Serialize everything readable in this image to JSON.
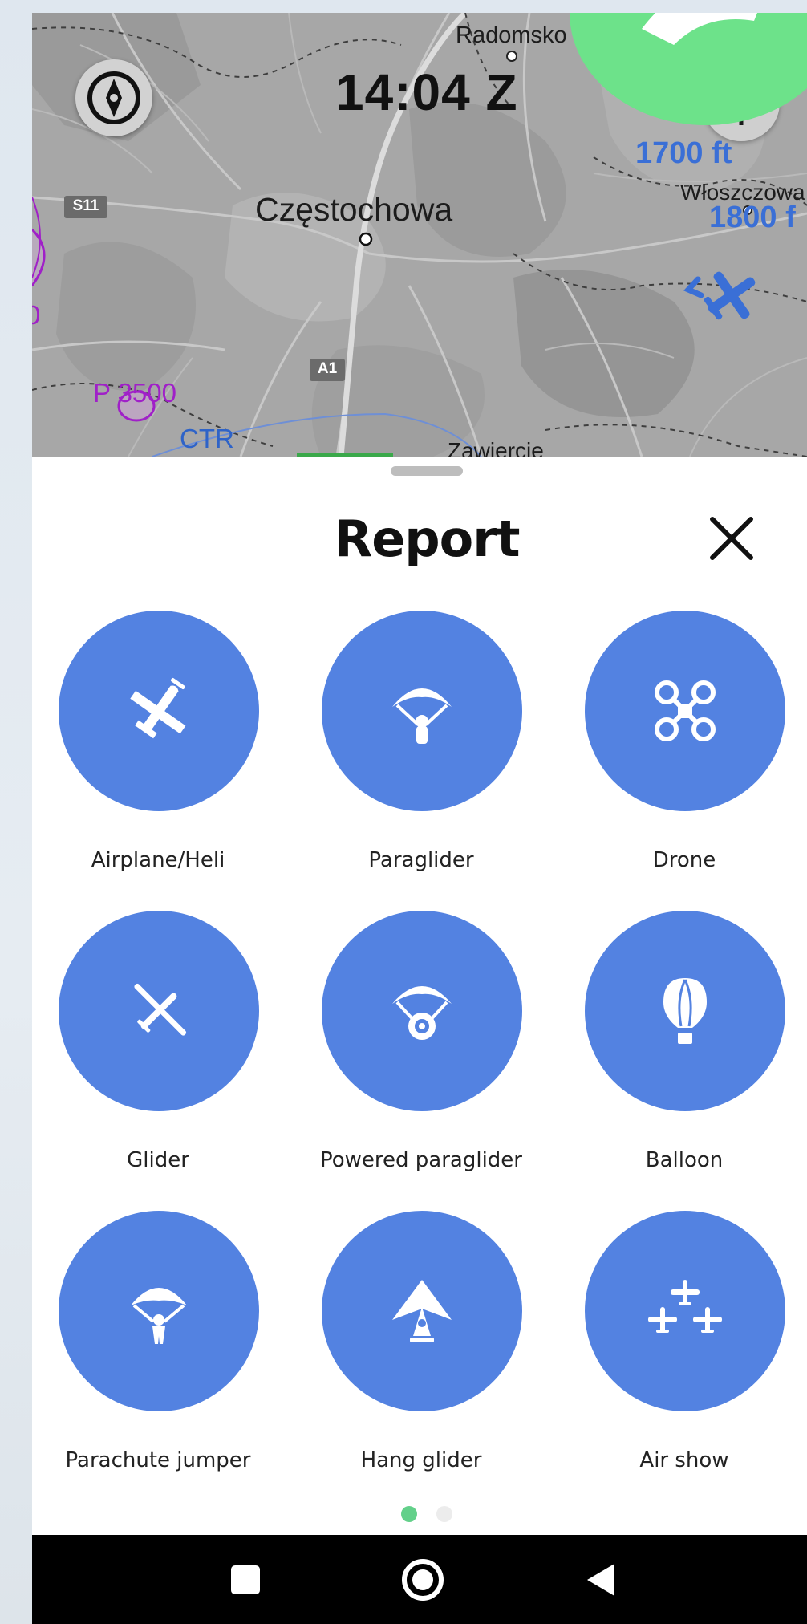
{
  "map": {
    "clock": "14:04 Z",
    "cities": {
      "radomsko": "Radomsko",
      "czestochowa": "Częstochowa",
      "wloszczowa": "Włoszczowa",
      "zawiercie": "Zawiercie"
    },
    "roads": {
      "s11": "S11",
      "a1": "A1"
    },
    "airspace": {
      "p3500": "P 3500",
      "ctr": "CTR",
      "left_edge": "0"
    },
    "traffic": {
      "alt_1": "1700 ft",
      "alt_2": "1800 f"
    },
    "colors": {
      "traffic_blue": "#3a6fd6",
      "airspace_purple": "#a020c8",
      "ctr_blue": "#2e63c8",
      "blob_green": "#6de28a"
    }
  },
  "sheet": {
    "title": "Report",
    "close_icon": "close-icon",
    "accent": "#5382e1",
    "items": [
      {
        "label": "Airplane/Heli",
        "icon": "airplane-icon"
      },
      {
        "label": "Paraglider",
        "icon": "paraglider-icon"
      },
      {
        "label": "Drone",
        "icon": "drone-icon"
      },
      {
        "label": "Glider",
        "icon": "glider-icon"
      },
      {
        "label": "Powered paraglider",
        "icon": "powered-paraglider-icon"
      },
      {
        "label": "Balloon",
        "icon": "balloon-icon"
      },
      {
        "label": "Parachute jumper",
        "icon": "parachute-icon"
      },
      {
        "label": "Hang glider",
        "icon": "hang-glider-icon"
      },
      {
        "label": "Air show",
        "icon": "air-show-icon"
      }
    ],
    "pager": {
      "pages": 2,
      "active": 0,
      "active_color": "#63d08a",
      "inactive_color": "#ececec"
    }
  },
  "navbar": {
    "buttons": [
      "recents-icon",
      "home-icon",
      "back-icon"
    ]
  }
}
